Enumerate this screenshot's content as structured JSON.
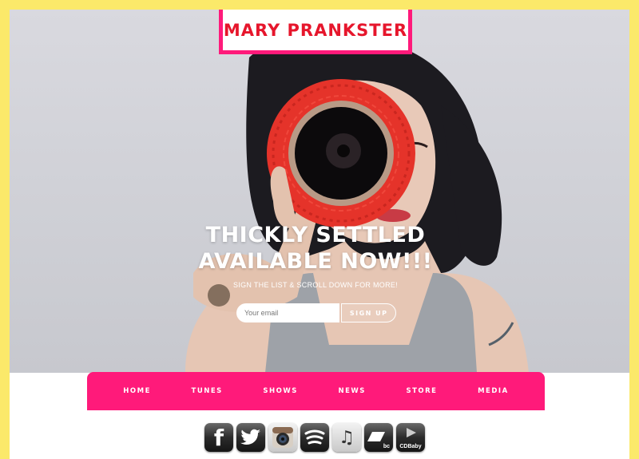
{
  "brand": {
    "name": "MARY PRANKSTER"
  },
  "hero": {
    "headline_line1": "THICKLY SETTLED",
    "headline_line2": "AVAILABLE NOW!!!",
    "subline": "SIGN THE LIST & SCROLL DOWN FOR MORE!",
    "email_placeholder": "Your email",
    "signup_label": "SIGN UP"
  },
  "nav": {
    "items": [
      {
        "label": "HOME"
      },
      {
        "label": "TUNES"
      },
      {
        "label": "SHOWS"
      },
      {
        "label": "NEWS"
      },
      {
        "label": "STORE"
      },
      {
        "label": "MEDIA"
      }
    ]
  },
  "social": {
    "icons": [
      {
        "name": "facebook-icon",
        "glyph": "f"
      },
      {
        "name": "twitter-icon",
        "glyph": "t"
      },
      {
        "name": "instagram-icon",
        "glyph": ""
      },
      {
        "name": "spotify-icon",
        "glyph": ""
      },
      {
        "name": "itunes-icon",
        "glyph": "♫"
      },
      {
        "name": "bandcamp-icon",
        "glyph": "bc"
      },
      {
        "name": "cdbaby-icon",
        "glyph": "CDBaby"
      }
    ]
  },
  "colors": {
    "border_yellow": "#fbe96a",
    "accent_pink": "#ff1a7a",
    "logo_red": "#e6162c",
    "yarn_red": "#e5332a"
  }
}
